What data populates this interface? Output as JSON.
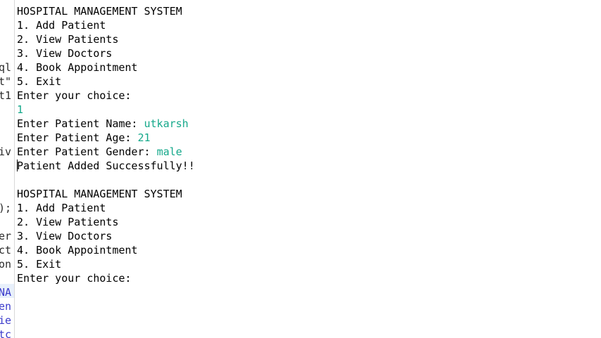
{
  "left_gutter": {
    "fragments": [
      {
        "text": "ql",
        "color": "#2a2a2a"
      },
      {
        "text": "t\"",
        "color": "#2a2a2a"
      },
      {
        "text": "t1",
        "color": "#2a2a2a"
      },
      {
        "text": "iv",
        "color": "#2a2a2a"
      },
      {
        "text": ");",
        "color": "#2a2a2a"
      },
      {
        "text": "er",
        "color": "#2a2a2a"
      },
      {
        "text": "ct",
        "color": "#2a2a2a"
      },
      {
        "text": "on",
        "color": "#2a2a2a"
      },
      {
        "text": "NA",
        "color": "#3a3acb"
      },
      {
        "text": "en",
        "color": "#3a3acb"
      },
      {
        "text": "ie",
        "color": "#3a3acb"
      },
      {
        "text": "tc",
        "color": "#3a3acb"
      }
    ]
  },
  "console": {
    "lines": [
      {
        "text": "HOSPITAL MANAGEMENT SYSTEM"
      },
      {
        "text": "1. Add Patient"
      },
      {
        "text": "2. View Patients"
      },
      {
        "text": "3. View Doctors"
      },
      {
        "text": "4. Book Appointment"
      },
      {
        "text": "5. Exit"
      },
      {
        "text": "Enter your choice:"
      },
      {
        "input": "1"
      },
      {
        "text": "Enter Patient Name: ",
        "input": "utkarsh"
      },
      {
        "text": "Enter Patient Age: ",
        "input": "21"
      },
      {
        "text": "Enter Patient Gender: ",
        "input": "male"
      },
      {
        "text": "Patient Added Successfully!!",
        "caret": true
      },
      {
        "text": ""
      },
      {
        "text": "HOSPITAL MANAGEMENT SYSTEM"
      },
      {
        "text": "1. Add Patient"
      },
      {
        "text": "2. View Patients"
      },
      {
        "text": "3. View Doctors"
      },
      {
        "text": "4. Book Appointment"
      },
      {
        "text": "5. Exit"
      },
      {
        "text": "Enter your choice:"
      }
    ],
    "colors": {
      "text": "#000000",
      "input": "#14a88a"
    }
  }
}
